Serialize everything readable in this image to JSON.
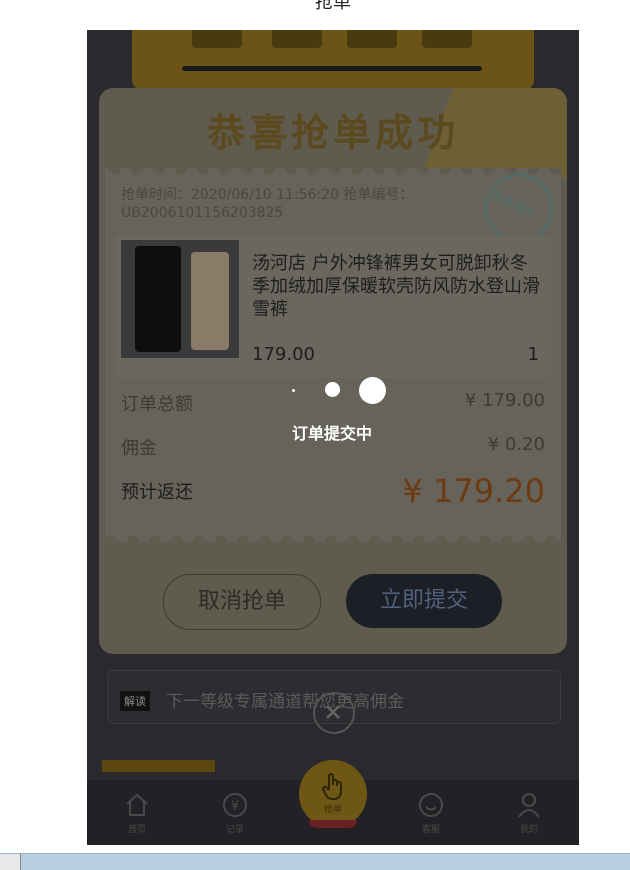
{
  "header": {
    "title": "抢单"
  },
  "dialog": {
    "title": "恭喜抢单成功",
    "stamp_text": "抢单成功",
    "meta": "抢单时间：2020/06/10 11:56:20 抢单编号：UB2006101156203825",
    "product": {
      "title": "汤河店 户外冲锋裤男女可脱卸秋冬季加绒加厚保暖软壳防风防水登山滑雪裤",
      "price": "179.00",
      "qty": "1"
    },
    "total_label": "订单总额",
    "total_value": "¥ 179.00",
    "commission_label": "佣金",
    "commission_value": "¥ 0.20",
    "estimated_label": "预计返还",
    "estimated_value": "¥ 179.20",
    "cancel_label": "取消抢单",
    "submit_label": "立即提交"
  },
  "loading": {
    "text": "订单提交中"
  },
  "background": {
    "tip_tag": "解读",
    "tip_text": "下一等级专属通道帮您更高佣金"
  },
  "tabbar": {
    "items": [
      {
        "label": "首页",
        "icon": "home-icon"
      },
      {
        "label": "记录",
        "icon": "record-icon"
      },
      {
        "label": "抢单",
        "icon": "grab-hand-icon"
      },
      {
        "label": "客服",
        "icon": "service-icon"
      },
      {
        "label": "我的",
        "icon": "user-icon"
      }
    ]
  },
  "colors": {
    "accent_gold": "#f5c518",
    "price_orange": "#e8862a",
    "submit_dark": "#1d1f26"
  }
}
